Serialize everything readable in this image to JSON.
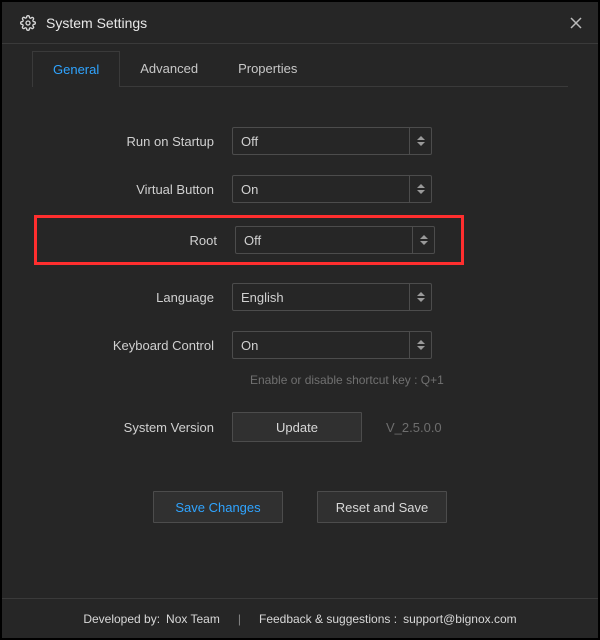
{
  "window": {
    "title": "System Settings"
  },
  "tabs": {
    "general": "General",
    "advanced": "Advanced",
    "properties": "Properties"
  },
  "form": {
    "startup": {
      "label": "Run on Startup",
      "value": "Off"
    },
    "vbutton": {
      "label": "Virtual Button",
      "value": "On"
    },
    "root": {
      "label": "Root",
      "value": "Off"
    },
    "language": {
      "label": "Language",
      "value": "English"
    },
    "keyboard": {
      "label": "Keyboard Control",
      "value": "On",
      "hint": "Enable or disable shortcut key : Q+1"
    },
    "version": {
      "label": "System Version",
      "update_btn": "Update",
      "value": "V_2.5.0.0"
    }
  },
  "actions": {
    "save": "Save Changes",
    "reset": "Reset and Save"
  },
  "footer": {
    "dev_prefix": "Developed by:",
    "dev_name": "Nox Team",
    "feedback_prefix": "Feedback & suggestions :",
    "email": "support@bignox.com"
  }
}
